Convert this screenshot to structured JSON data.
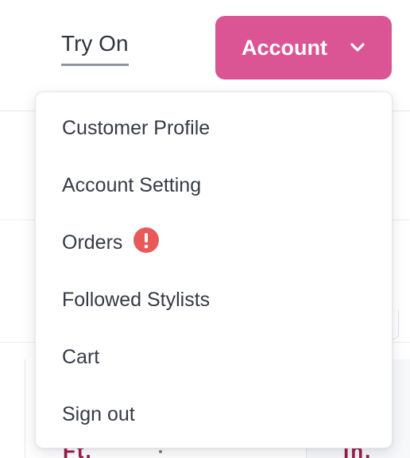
{
  "nav": {
    "try_on_label": "Try On",
    "account_button_label": "Account",
    "account_button_icon": "chevron-down-icon",
    "account_color": "#db5594"
  },
  "dropdown": {
    "items": [
      {
        "label": "Customer Profile"
      },
      {
        "label": "Account Setting"
      },
      {
        "label": "Orders",
        "badge_icon": "alert-icon",
        "badge_color": "#e85a5a"
      },
      {
        "label": "Followed Stylists"
      },
      {
        "label": "Cart"
      },
      {
        "label": "Sign out"
      }
    ]
  },
  "background": {
    "peek_left_text": "Ft.",
    "peek_right_text": "In."
  }
}
